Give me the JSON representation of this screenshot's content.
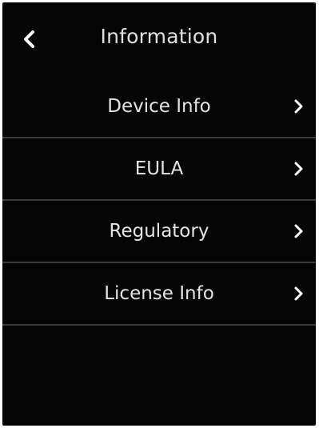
{
  "header": {
    "title": "Information",
    "back_icon": "chevron-left-icon"
  },
  "menu": {
    "items": [
      {
        "label": "Device Info",
        "icon": "chevron-right-icon"
      },
      {
        "label": "EULA",
        "icon": "chevron-right-icon"
      },
      {
        "label": "Regulatory",
        "icon": "chevron-right-icon"
      },
      {
        "label": "License Info",
        "icon": "chevron-right-icon"
      }
    ]
  },
  "colors": {
    "background": "#050505",
    "text": "#e4e4e4",
    "divider": "#3a3a3a"
  }
}
